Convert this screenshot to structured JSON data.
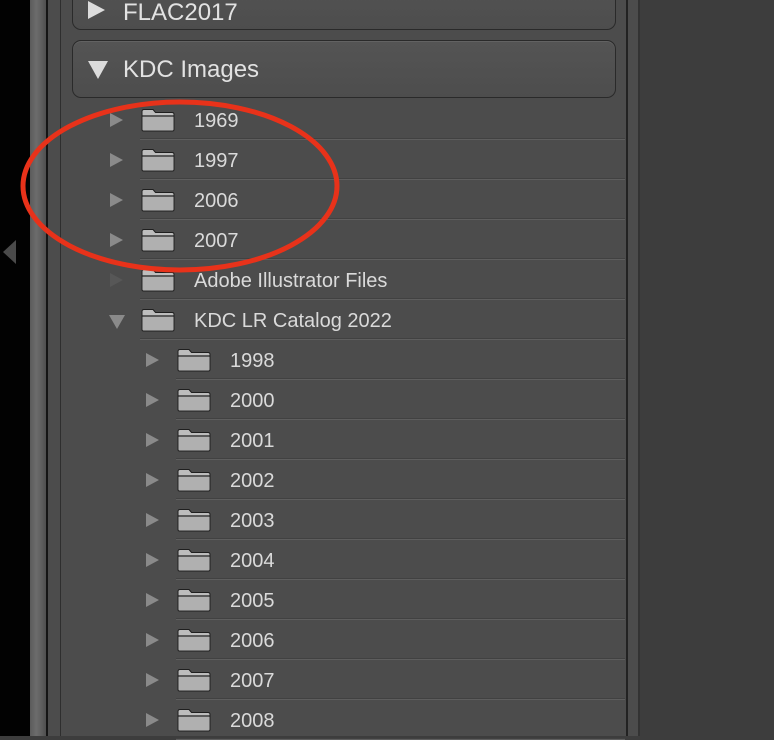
{
  "volumes": [
    {
      "name": "FLAC2017",
      "expanded": false
    },
    {
      "name": "KDC Images",
      "expanded": true
    }
  ],
  "folders": [
    {
      "label": "1969",
      "level": 0,
      "state": "collapsed"
    },
    {
      "label": "1997",
      "level": 0,
      "state": "collapsed"
    },
    {
      "label": "2006",
      "level": 0,
      "state": "collapsed"
    },
    {
      "label": "2007",
      "level": 0,
      "state": "collapsed"
    },
    {
      "label": "Adobe Illustrator Files",
      "level": 0,
      "state": "empty"
    },
    {
      "label": "KDC LR Catalog 2022",
      "level": 0,
      "state": "expanded"
    },
    {
      "label": "1998",
      "level": 1,
      "state": "collapsed"
    },
    {
      "label": "2000",
      "level": 1,
      "state": "collapsed"
    },
    {
      "label": "2001",
      "level": 1,
      "state": "collapsed"
    },
    {
      "label": "2002",
      "level": 1,
      "state": "collapsed"
    },
    {
      "label": "2003",
      "level": 1,
      "state": "collapsed"
    },
    {
      "label": "2004",
      "level": 1,
      "state": "collapsed"
    },
    {
      "label": "2005",
      "level": 1,
      "state": "collapsed"
    },
    {
      "label": "2006",
      "level": 1,
      "state": "collapsed"
    },
    {
      "label": "2007",
      "level": 1,
      "state": "collapsed"
    },
    {
      "label": "2008",
      "level": 1,
      "state": "collapsed"
    }
  ],
  "annotation": {
    "color": "#e8321a"
  },
  "colors": {
    "panel": "#4c4c4c",
    "text": "#dadada",
    "triangle": "#8a8a8a"
  }
}
